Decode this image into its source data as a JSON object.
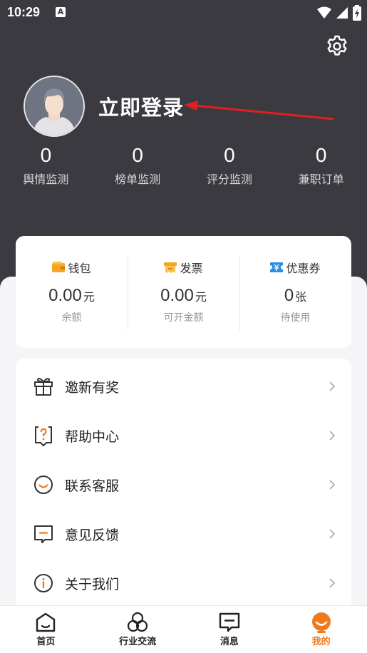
{
  "status_bar": {
    "time": "10:29",
    "notification_glyph": "A"
  },
  "profile": {
    "login_text": "立即登录"
  },
  "stats": [
    {
      "value": "0",
      "label": "舆情监测"
    },
    {
      "value": "0",
      "label": "榜单监测"
    },
    {
      "value": "0",
      "label": "评分监测"
    },
    {
      "value": "0",
      "label": "兼职订单"
    }
  ],
  "wallet_card": {
    "wallet": {
      "title": "钱包",
      "value": "0.00",
      "unit": "元",
      "sub": "余额"
    },
    "invoice": {
      "title": "发票",
      "value": "0.00",
      "unit": "元",
      "sub": "可开金额"
    },
    "coupon": {
      "title": "优惠券",
      "value": "0",
      "unit": "张",
      "sub": "待使用"
    }
  },
  "menu": [
    {
      "label": "邀新有奖",
      "icon": "gift-icon"
    },
    {
      "label": "帮助中心",
      "icon": "help-icon"
    },
    {
      "label": "联系客服",
      "icon": "customer-service-icon"
    },
    {
      "label": "意见反馈",
      "icon": "feedback-icon"
    },
    {
      "label": "关于我们",
      "icon": "info-icon"
    }
  ],
  "bottom_nav": [
    {
      "label": "首页",
      "icon": "home-icon",
      "active": false
    },
    {
      "label": "行业交流",
      "icon": "community-icon",
      "active": false
    },
    {
      "label": "消息",
      "icon": "message-icon",
      "active": false
    },
    {
      "label": "我的",
      "icon": "profile-icon",
      "active": true
    }
  ],
  "colors": {
    "header_bg": "#3b3a40",
    "accent": "#f07b1e",
    "annotation_arrow": "#e02020"
  }
}
